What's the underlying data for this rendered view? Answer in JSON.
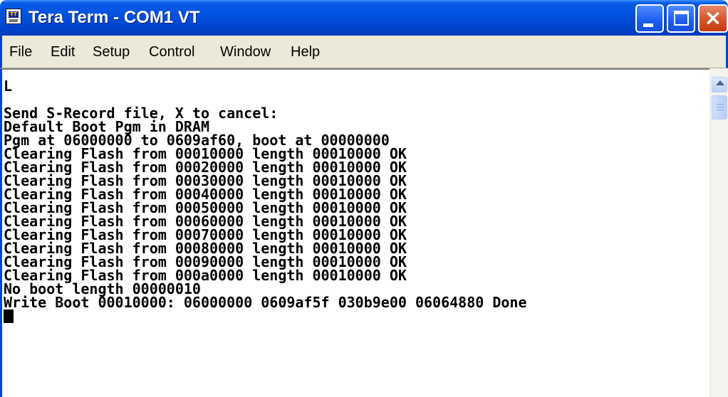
{
  "window": {
    "title": "Tera Term - COM1 VT",
    "icon": "teraterm-app-icon",
    "controls": [
      "minimize-icon",
      "maximize-icon",
      "close-icon"
    ]
  },
  "menu": {
    "items": [
      "File",
      "Edit",
      "Setup",
      "Control",
      "Window",
      "Help"
    ]
  },
  "terminal": {
    "lines": [
      "L",
      "",
      "Send S-Record file, X to cancel:",
      "Default Boot Pgm in DRAM",
      "Pgm at 06000000 to 0609af60, boot at 00000000",
      "Clearing Flash from 00010000 length 00010000 OK",
      "Clearing Flash from 00020000 length 00010000 OK",
      "Clearing Flash from 00030000 length 00010000 OK",
      "Clearing Flash from 00040000 length 00010000 OK",
      "Clearing Flash from 00050000 length 00010000 OK",
      "Clearing Flash from 00060000 length 00010000 OK",
      "Clearing Flash from 00070000 length 00010000 OK",
      "Clearing Flash from 00080000 length 00010000 OK",
      "Clearing Flash from 00090000 length 00010000 OK",
      "Clearing Flash from 000a0000 length 00010000 OK",
      "No boot length 00000010",
      "Write Boot 00010000: 06000000 0609af5f 030b9e00 06064880 Done"
    ]
  },
  "colors": {
    "titlebar": "#0053e0",
    "menubar": "#ece9d8",
    "terminal_bg": "#ffffff",
    "terminal_fg": "#000000",
    "close_button": "#d5542b"
  }
}
